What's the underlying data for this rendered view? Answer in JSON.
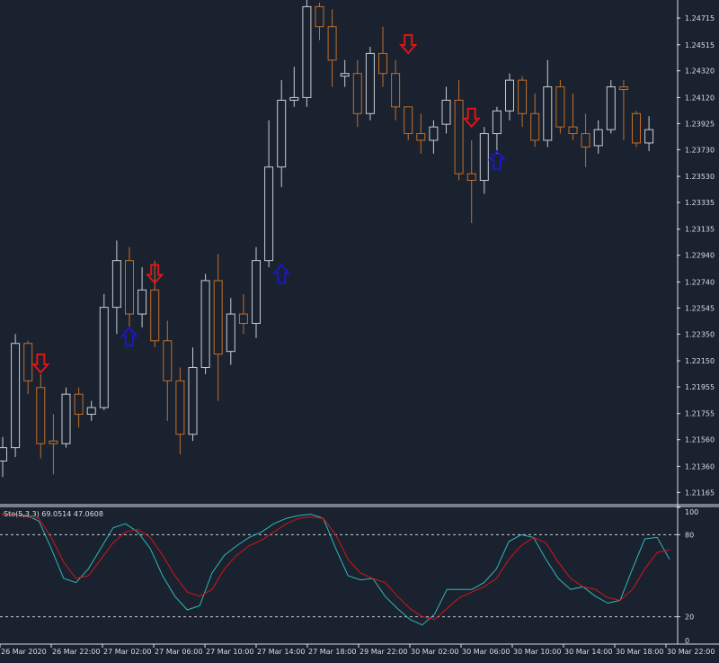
{
  "colors": {
    "background": "#1a2230",
    "bull_candle": "#c8ccd2",
    "bear_candle": "#c26e28",
    "buy_arrow": "#1a17c8",
    "sell_arrow": "#e01414",
    "stoch_main": "#2fb8b8",
    "stoch_signal": "#d31515",
    "axis": "#d8dde4",
    "level_line": "#c8ccd2"
  },
  "indicator": {
    "label": "Sto(5,3,3) 69.0514 47.0608",
    "levels": [
      20,
      80
    ],
    "scale_labels": [
      "100",
      "80",
      "20",
      "0"
    ]
  },
  "chart_data": [
    {
      "type": "candlestick",
      "ylim": [
        1.2108,
        1.2485
      ],
      "y_ticks": [
        "1.24715",
        "1.24515",
        "1.24320",
        "1.24120",
        "1.23925",
        "1.23730",
        "1.23530",
        "1.23335",
        "1.23135",
        "1.22940",
        "1.22740",
        "1.22545",
        "1.22350",
        "1.22150",
        "1.21955",
        "1.21755",
        "1.21560",
        "1.21360",
        "1.21165"
      ],
      "x_ticks": [
        "26 Mar 2020",
        "26 Mar 22:00",
        "27 Mar 02:00",
        "27 Mar 06:00",
        "27 Mar 10:00",
        "27 Mar 14:00",
        "27 Mar 18:00",
        "29 Mar 22:00",
        "30 Mar 02:00",
        "30 Mar 06:00",
        "30 Mar 10:00",
        "30 Mar 14:00",
        "30 Mar 18:00",
        "30 Mar 22:00"
      ],
      "candles": [
        {
          "o": 1.214,
          "h": 1.2158,
          "l": 1.2128,
          "c": 1.215
        },
        {
          "o": 1.215,
          "h": 1.2235,
          "l": 1.2143,
          "c": 1.2228
        },
        {
          "o": 1.2228,
          "h": 1.223,
          "l": 1.219,
          "c": 1.22
        },
        {
          "o": 1.2195,
          "h": 1.2205,
          "l": 1.2142,
          "c": 1.2153
        },
        {
          "o": 1.2155,
          "h": 1.2175,
          "l": 1.213,
          "c": 1.2153
        },
        {
          "o": 1.2153,
          "h": 1.2195,
          "l": 1.215,
          "c": 1.219
        },
        {
          "o": 1.219,
          "h": 1.2195,
          "l": 1.2165,
          "c": 1.2175
        },
        {
          "o": 1.2175,
          "h": 1.2185,
          "l": 1.217,
          "c": 1.218
        },
        {
          "o": 1.218,
          "h": 1.2265,
          "l": 1.2178,
          "c": 1.2255
        },
        {
          "o": 1.2255,
          "h": 1.2305,
          "l": 1.2235,
          "c": 1.229
        },
        {
          "o": 1.229,
          "h": 1.23,
          "l": 1.224,
          "c": 1.225
        },
        {
          "o": 1.225,
          "h": 1.2285,
          "l": 1.224,
          "c": 1.2268
        },
        {
          "o": 1.2268,
          "h": 1.229,
          "l": 1.2225,
          "c": 1.223
        },
        {
          "o": 1.223,
          "h": 1.2245,
          "l": 1.217,
          "c": 1.22
        },
        {
          "o": 1.22,
          "h": 1.221,
          "l": 1.2145,
          "c": 1.216
        },
        {
          "o": 1.216,
          "h": 1.2225,
          "l": 1.2155,
          "c": 1.221
        },
        {
          "o": 1.221,
          "h": 1.228,
          "l": 1.2205,
          "c": 1.2275
        },
        {
          "o": 1.2275,
          "h": 1.2295,
          "l": 1.2185,
          "c": 1.222
        },
        {
          "o": 1.2222,
          "h": 1.2262,
          "l": 1.2212,
          "c": 1.225
        },
        {
          "o": 1.225,
          "h": 1.2265,
          "l": 1.2235,
          "c": 1.2243
        },
        {
          "o": 1.2243,
          "h": 1.23,
          "l": 1.2232,
          "c": 1.229
        },
        {
          "o": 1.229,
          "h": 1.2395,
          "l": 1.2285,
          "c": 1.236
        },
        {
          "o": 1.236,
          "h": 1.2425,
          "l": 1.2345,
          "c": 1.241
        },
        {
          "o": 1.241,
          "h": 1.2435,
          "l": 1.2405,
          "c": 1.2412
        },
        {
          "o": 1.2412,
          "h": 1.2485,
          "l": 1.2405,
          "c": 1.248
        },
        {
          "o": 1.248,
          "h": 1.2483,
          "l": 1.2455,
          "c": 1.2465
        },
        {
          "o": 1.2465,
          "h": 1.2478,
          "l": 1.242,
          "c": 1.244
        },
        {
          "o": 1.2428,
          "h": 1.244,
          "l": 1.242,
          "c": 1.243
        },
        {
          "o": 1.243,
          "h": 1.244,
          "l": 1.239,
          "c": 1.24
        },
        {
          "o": 1.24,
          "h": 1.245,
          "l": 1.2395,
          "c": 1.2445
        },
        {
          "o": 1.2445,
          "h": 1.2465,
          "l": 1.242,
          "c": 1.243
        },
        {
          "o": 1.243,
          "h": 1.244,
          "l": 1.2395,
          "c": 1.2405
        },
        {
          "o": 1.2405,
          "h": 1.24,
          "l": 1.238,
          "c": 1.2385
        },
        {
          "o": 1.2385,
          "h": 1.24,
          "l": 1.237,
          "c": 1.238
        },
        {
          "o": 1.238,
          "h": 1.2395,
          "l": 1.237,
          "c": 1.239
        },
        {
          "o": 1.2392,
          "h": 1.242,
          "l": 1.2385,
          "c": 1.241
        },
        {
          "o": 1.241,
          "h": 1.2425,
          "l": 1.235,
          "c": 1.2355
        },
        {
          "o": 1.2355,
          "h": 1.238,
          "l": 1.2318,
          "c": 1.235
        },
        {
          "o": 1.235,
          "h": 1.239,
          "l": 1.234,
          "c": 1.2385
        },
        {
          "o": 1.2385,
          "h": 1.2405,
          "l": 1.237,
          "c": 1.2402
        },
        {
          "o": 1.2402,
          "h": 1.243,
          "l": 1.2395,
          "c": 1.2425
        },
        {
          "o": 1.2425,
          "h": 1.2428,
          "l": 1.239,
          "c": 1.24
        },
        {
          "o": 1.24,
          "h": 1.2415,
          "l": 1.2375,
          "c": 1.238
        },
        {
          "o": 1.238,
          "h": 1.244,
          "l": 1.2375,
          "c": 1.242
        },
        {
          "o": 1.242,
          "h": 1.2425,
          "l": 1.2385,
          "c": 1.239
        },
        {
          "o": 1.239,
          "h": 1.2415,
          "l": 1.238,
          "c": 1.2385
        },
        {
          "o": 1.2385,
          "h": 1.24,
          "l": 1.236,
          "c": 1.2375
        },
        {
          "o": 1.2376,
          "h": 1.2395,
          "l": 1.237,
          "c": 1.2388
        },
        {
          "o": 1.2388,
          "h": 1.2425,
          "l": 1.2385,
          "c": 1.242
        },
        {
          "o": 1.242,
          "h": 1.2425,
          "l": 1.238,
          "c": 1.2418
        },
        {
          "o": 1.24,
          "h": 1.2402,
          "l": 1.2375,
          "c": 1.2378
        },
        {
          "o": 1.2378,
          "h": 1.2398,
          "l": 1.2372,
          "c": 1.2388
        }
      ],
      "signals": [
        {
          "index": 3,
          "type": "sell",
          "price": 1.2213
        },
        {
          "index": 10,
          "type": "buy",
          "price": 1.2233
        },
        {
          "index": 12,
          "type": "sell",
          "price": 1.228
        },
        {
          "index": 22,
          "type": "buy",
          "price": 1.228
        },
        {
          "index": 32,
          "type": "sell",
          "price": 1.2452
        },
        {
          "index": 37,
          "type": "sell",
          "price": 1.2397
        },
        {
          "index": 39,
          "type": "buy",
          "price": 1.2365
        }
      ]
    },
    {
      "type": "line",
      "name": "Sto(5,3,3)",
      "ylim": [
        0,
        100
      ],
      "series": [
        {
          "values": [
            95,
            95,
            94,
            90,
            70,
            48,
            45,
            55,
            70,
            85,
            88,
            82,
            70,
            50,
            35,
            25,
            28,
            52,
            65,
            72,
            78,
            82,
            88,
            92,
            94,
            95,
            92,
            70,
            50,
            47,
            48,
            35,
            26,
            18,
            14,
            22,
            40,
            40,
            40,
            45,
            55,
            75,
            80,
            78,
            62,
            48,
            40,
            42,
            35,
            30,
            32,
            55,
            77,
            78,
            62
          ]
        },
        {
          "values": [
            95,
            95,
            93,
            92,
            78,
            60,
            48,
            50,
            62,
            74,
            82,
            84,
            78,
            65,
            50,
            38,
            35,
            40,
            55,
            65,
            72,
            76,
            82,
            88,
            92,
            93,
            92,
            80,
            62,
            52,
            48,
            45,
            35,
            26,
            20,
            18,
            26,
            34,
            38,
            42,
            48,
            62,
            72,
            78,
            74,
            60,
            48,
            42,
            40,
            34,
            32,
            40,
            55,
            67,
            69
          ]
        }
      ]
    }
  ]
}
